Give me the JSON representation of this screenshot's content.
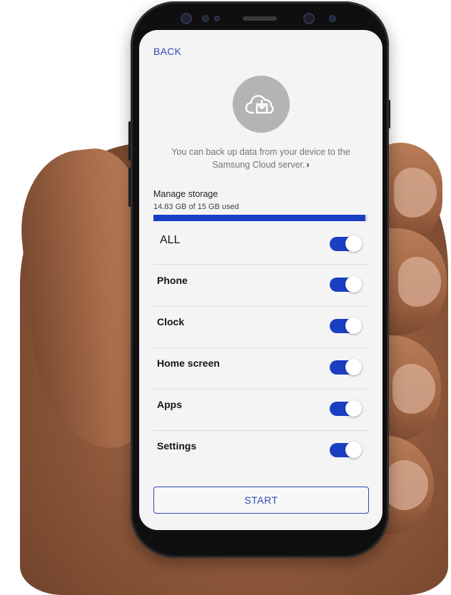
{
  "header": {
    "back_label": "BACK"
  },
  "hero": {
    "icon": "cloud-backup-icon",
    "info_text": "You can back up data from your device to the Samsung Cloud server.",
    "info_chevron": "›"
  },
  "storage": {
    "title": "Manage storage",
    "used_text": "14.83 GB of 15 GB used",
    "used_fraction": 0.989
  },
  "toggles": [
    {
      "label": "ALL",
      "on": true
    },
    {
      "label": "Phone",
      "on": true
    },
    {
      "label": "Clock",
      "on": true
    },
    {
      "label": "Home screen",
      "on": true
    },
    {
      "label": "Apps",
      "on": true
    },
    {
      "label": "Settings",
      "on": true
    }
  ],
  "footer": {
    "start_label": "START"
  },
  "colors": {
    "accent": "#1a3fc2",
    "link": "#2c4bb8",
    "screen_bg": "#f4f4f4"
  }
}
